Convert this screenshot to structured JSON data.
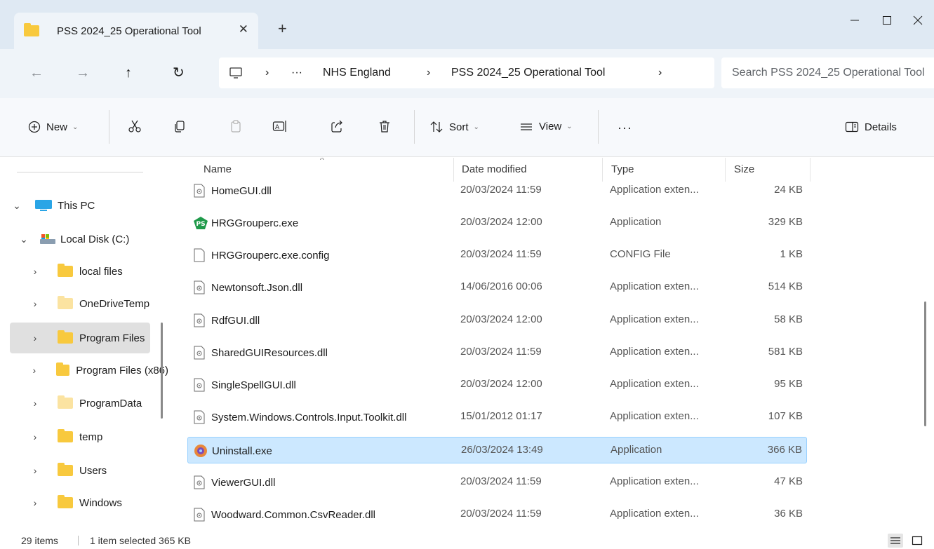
{
  "window": {
    "tab_title": "PSS 2024_25 Operational Tool",
    "tab_close": "✕",
    "new_tab": "+",
    "controls": {
      "minimize": "—",
      "maximize": "☐",
      "close": "✕"
    }
  },
  "nav": {
    "back": "←",
    "forward": "→",
    "up": "↑",
    "refresh": "↻"
  },
  "address": {
    "sep1": "›",
    "ellipsis": "···",
    "crumb1": "NHS England",
    "sep2": "›",
    "crumb2": "PSS 2024_25 Operational Tool",
    "sep3": "›"
  },
  "search": {
    "placeholder": "Search PSS 2024_25 Operational Tool"
  },
  "toolbar": {
    "new_label": "New",
    "sort_label": "Sort",
    "view_label": "View",
    "more_label": "···",
    "details_label": "Details",
    "chevron": "⌄"
  },
  "tree": [
    {
      "label": "This PC",
      "chevron": "⌄",
      "selected": false
    },
    {
      "label": "Local Disk (C:)",
      "chevron": "⌄",
      "selected": false
    },
    {
      "label": "local files",
      "chevron": "›",
      "selected": false
    },
    {
      "label": "OneDriveTemp",
      "chevron": "›",
      "selected": false
    },
    {
      "label": "Program Files",
      "chevron": "›",
      "selected": true
    },
    {
      "label": "Program Files (x86)",
      "chevron": "›",
      "selected": false
    },
    {
      "label": "ProgramData",
      "chevron": "›",
      "selected": false
    },
    {
      "label": "temp",
      "chevron": "›",
      "selected": false
    },
    {
      "label": "Users",
      "chevron": "›",
      "selected": false
    },
    {
      "label": "Windows",
      "chevron": "›",
      "selected": false
    }
  ],
  "columns": {
    "name": "Name",
    "date": "Date modified",
    "type": "Type",
    "size": "Size",
    "sort_arrow": "^"
  },
  "files": [
    {
      "name": "HomeGUI.dll",
      "date": "20/03/2024 11:59",
      "type": "Application exten...",
      "size": "24 KB",
      "icon": "dll-icon"
    },
    {
      "name": "HRGGrouperc.exe",
      "date": "20/03/2024 12:00",
      "type": "Application",
      "size": "329 KB",
      "icon": "ps-app-icon",
      "icon_text": "PS"
    },
    {
      "name": "HRGGrouperc.exe.config",
      "date": "20/03/2024 11:59",
      "type": "CONFIG File",
      "size": "1 KB",
      "icon": "blank-file-icon"
    },
    {
      "name": "Newtonsoft.Json.dll",
      "date": "14/06/2016 00:06",
      "type": "Application exten...",
      "size": "514 KB",
      "icon": "dll-icon"
    },
    {
      "name": "RdfGUI.dll",
      "date": "20/03/2024 12:00",
      "type": "Application exten...",
      "size": "58 KB",
      "icon": "dll-icon"
    },
    {
      "name": "SharedGUIResources.dll",
      "date": "20/03/2024 11:59",
      "type": "Application exten...",
      "size": "581 KB",
      "icon": "dll-icon"
    },
    {
      "name": "SingleSpellGUI.dll",
      "date": "20/03/2024 12:00",
      "type": "Application exten...",
      "size": "95 KB",
      "icon": "dll-icon"
    },
    {
      "name": "System.Windows.Controls.Input.Toolkit.dll",
      "date": "15/01/2012 01:17",
      "type": "Application exten...",
      "size": "107 KB",
      "icon": "dll-icon"
    },
    {
      "name": "Uninstall.exe",
      "date": "26/03/2024 13:49",
      "type": "Application",
      "size": "366 KB",
      "icon": "uninstall-icon",
      "selected": true
    },
    {
      "name": "ViewerGUI.dll",
      "date": "20/03/2024 11:59",
      "type": "Application exten...",
      "size": "47 KB",
      "icon": "dll-icon"
    },
    {
      "name": "Woodward.Common.CsvReader.dll",
      "date": "20/03/2024 11:59",
      "type": "Application exten...",
      "size": "36 KB",
      "icon": "dll-icon"
    }
  ],
  "status": {
    "item_count": "29 items",
    "selection": "1 item selected  365 KB"
  },
  "colors": {
    "folder": "#f8c93e",
    "folder_light": "#fbe3a1",
    "selection_bg": "#cce8ff",
    "selection_border": "#99d1ff",
    "ps_green": "#1f9a4a"
  }
}
